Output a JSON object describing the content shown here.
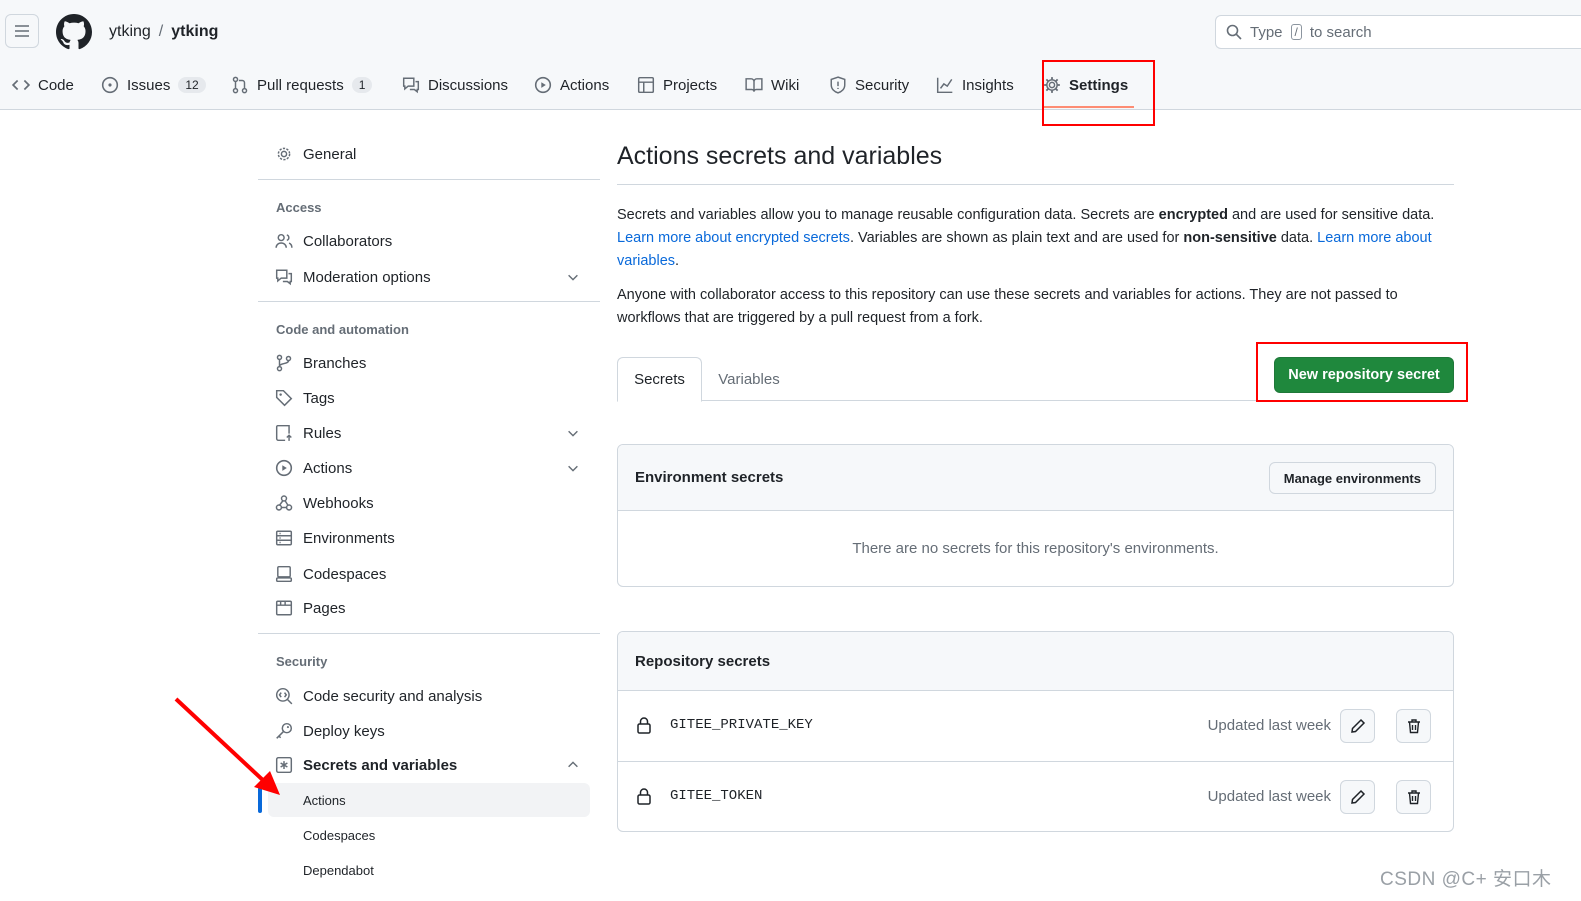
{
  "header": {
    "owner": "ytking",
    "separator": "/",
    "repo": "ytking",
    "search": {
      "prefix": "Type",
      "key": "/",
      "suffix": "to search"
    }
  },
  "nav": [
    {
      "label": "Code",
      "icon": "code-icon"
    },
    {
      "label": "Issues",
      "icon": "issue-icon",
      "count": "12"
    },
    {
      "label": "Pull requests",
      "icon": "pull-request-icon",
      "count": "1"
    },
    {
      "label": "Discussions",
      "icon": "discussion-icon"
    },
    {
      "label": "Actions",
      "icon": "play-icon"
    },
    {
      "label": "Projects",
      "icon": "table-icon"
    },
    {
      "label": "Wiki",
      "icon": "book-icon"
    },
    {
      "label": "Security",
      "icon": "shield-icon"
    },
    {
      "label": "Insights",
      "icon": "graph-icon"
    },
    {
      "label": "Settings",
      "icon": "gear-icon",
      "selected": true
    }
  ],
  "sidebar": {
    "general": "General",
    "access_heading": "Access",
    "access": [
      "Collaborators",
      "Moderation options"
    ],
    "code_heading": "Code and automation",
    "code": [
      "Branches",
      "Tags",
      "Rules",
      "Actions",
      "Webhooks",
      "Environments",
      "Codespaces",
      "Pages"
    ],
    "security_heading": "Security",
    "security": [
      "Code security and analysis",
      "Deploy keys",
      "Secrets and variables"
    ],
    "secrets_sub": [
      "Actions",
      "Codespaces",
      "Dependabot"
    ]
  },
  "main": {
    "title": "Actions secrets and variables",
    "intro": {
      "p1a": "Secrets and variables allow you to manage reusable configuration data. Secrets are ",
      "p1b": "encrypted",
      "p1c": " and are used for sensitive data. ",
      "link1": "Learn more about encrypted secrets",
      "p1d": ". Variables are shown as plain text and are used for ",
      "p1e": "non-sensitive",
      "p1f": " data. ",
      "link2": "Learn more about variables",
      "p1g": "."
    },
    "access_note": "Anyone with collaborator access to this repository can use these secrets and variables for actions. They are not passed to workflows that are triggered by a pull request from a fork.",
    "tabs": [
      "Secrets",
      "Variables"
    ],
    "new_button": "New repository secret",
    "env_box": {
      "title": "Environment secrets",
      "manage_button": "Manage environments",
      "empty": "There are no secrets for this repository's environments."
    },
    "repo_box": {
      "title": "Repository secrets",
      "rows": [
        {
          "name": "GITEE_PRIVATE_KEY",
          "updated": "Updated last week"
        },
        {
          "name": "GITEE_TOKEN",
          "updated": "Updated last week"
        }
      ]
    }
  },
  "watermark": "CSDN @C+ 安口木",
  "colors": {
    "primary_button": "#1f883d",
    "link": "#0969da",
    "annotation": "#ff0000",
    "selected_underline": "#fd8c73"
  }
}
